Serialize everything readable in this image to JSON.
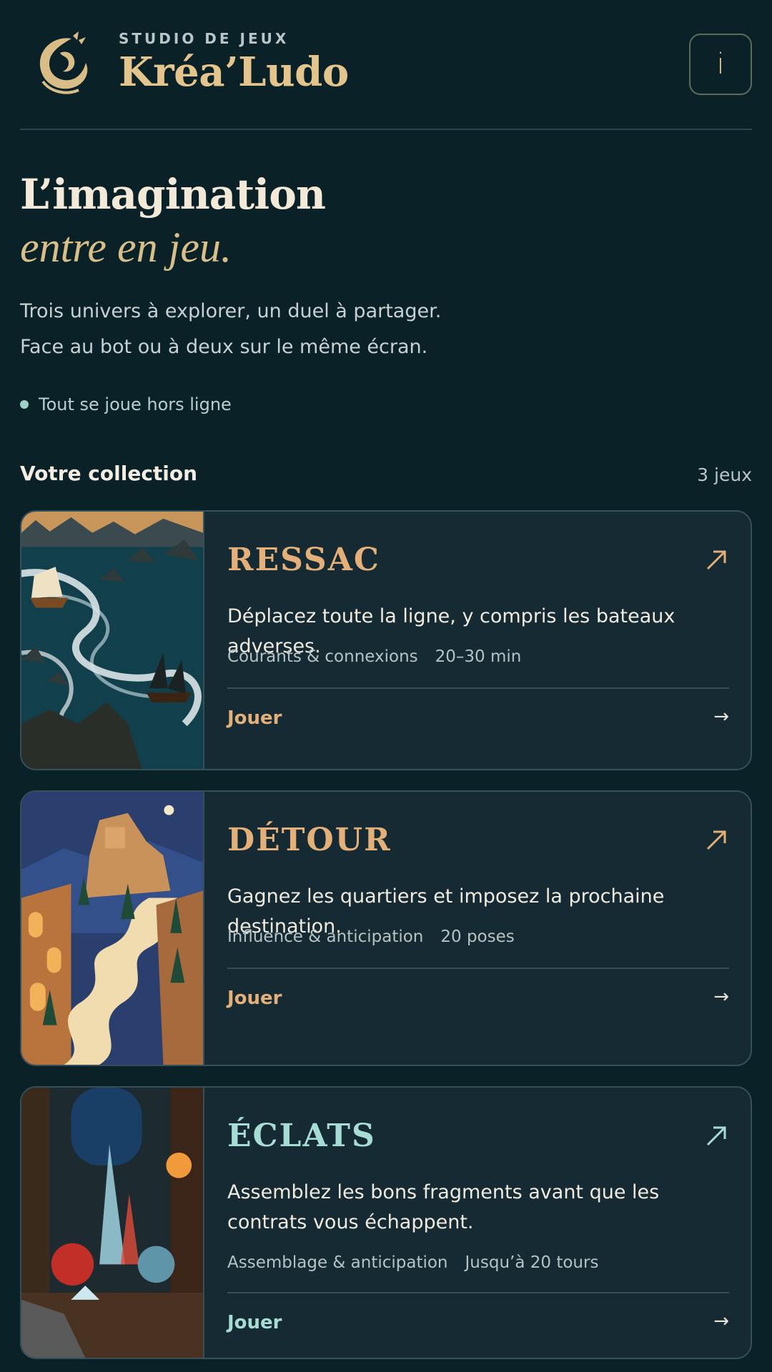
{
  "header": {
    "studio": "STUDIO DE JEUX",
    "brand": "Kréa’Ludo",
    "info_label": "i"
  },
  "hero": {
    "line1": "L’imagination",
    "line2": "entre en jeu.",
    "intro1": "Trois univers à explorer, un duel à partager.",
    "intro2": "Face au bot ou à deux sur le même écran.",
    "offline": "Tout se joue hors ligne"
  },
  "collection": {
    "title": "Votre collection",
    "count": "3 jeux"
  },
  "games": [
    {
      "title": "RESSAC",
      "description": "Déplacez toute la ligne, y compris les bateaux adverses.",
      "tag": "Courants & connexions",
      "duration": "20–30 min",
      "play": "Jouer",
      "play_arrow": "→",
      "accent": "#e3b07a"
    },
    {
      "title": "DÉTOUR",
      "description": "Gagnez les quartiers et imposez la prochaine destination.",
      "tag": "Influence & anticipation",
      "duration": "20 poses",
      "play": "Jouer",
      "play_arrow": "→",
      "accent": "#e3b07a"
    },
    {
      "title": "ÉCLATS",
      "description": "Assemblez les bons fragments avant que les contrats vous échappent.",
      "tag": "Assemblage & anticipation",
      "duration": "Jusqu’à 20 tours",
      "play": "Jouer",
      "play_arrow": "→",
      "accent": "#a7dcd4"
    }
  ],
  "colors": {
    "background": "#0b2128",
    "card": "#152a33",
    "gold": "#e3c48d",
    "teal": "#a7dcd4"
  }
}
